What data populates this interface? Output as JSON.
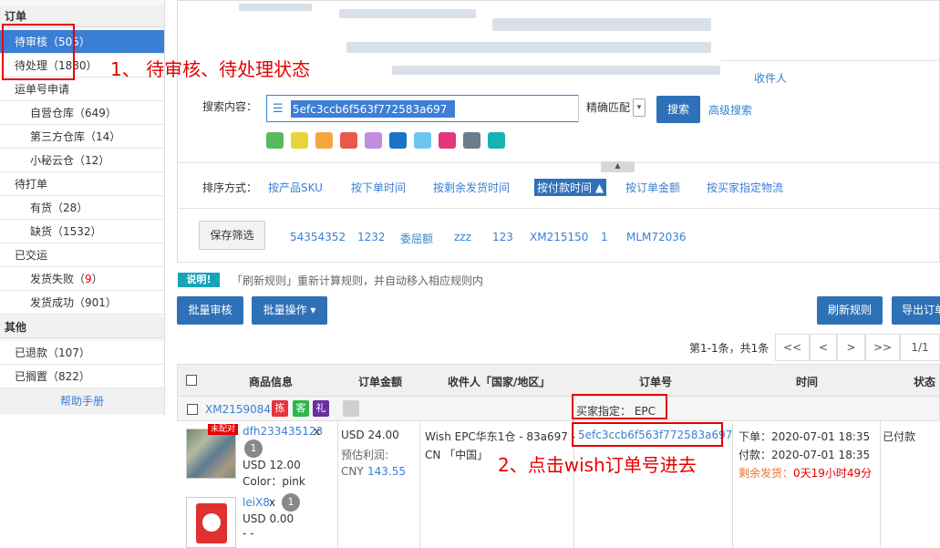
{
  "sidebar": {
    "sections": [
      {
        "label": "订单"
      },
      {
        "label": "其他"
      }
    ],
    "items": [
      {
        "label": "待审核",
        "count": "（505）"
      },
      {
        "label": "待处理",
        "count": "（1880）"
      },
      {
        "label": "运单号申请",
        "count": ""
      },
      {
        "label": "自营仓库",
        "count": "（649）"
      },
      {
        "label": "第三方仓库",
        "count": "（14）"
      },
      {
        "label": "小秘云仓",
        "count": "（12）"
      },
      {
        "label": "待打单",
        "count": ""
      },
      {
        "label": "有货",
        "count": "（28）"
      },
      {
        "label": "缺货",
        "count": "（1532）"
      },
      {
        "label": "已交运",
        "count": ""
      },
      {
        "label": "发货失败",
        "count_pre": "（",
        "count_num": "9",
        "count_post": "）"
      },
      {
        "label": "发货成功",
        "count": "（901）"
      },
      {
        "label": "已退款",
        "count": "（107）"
      },
      {
        "label": "已搁置",
        "count": "（822）"
      }
    ],
    "help": "帮助手册"
  },
  "annotations": {
    "step1": "1、 待审核、待处理状态",
    "step2": "2、点击wish订单号进去"
  },
  "search": {
    "recipient_link": "收件人",
    "label": "搜索内容：",
    "value": "5efc3ccb6f563f772583a697",
    "match_mode": "精确匹配",
    "search_button": "搜索",
    "advanced": "高级搜索",
    "swatch_colors": [
      "#5cb85c",
      "#e8d43a",
      "#f5a742",
      "#e8594a",
      "#c18de0",
      "#1a73c7",
      "#6ec6f0",
      "#e5357e",
      "#6b7c8a",
      "#17b3b3"
    ]
  },
  "sort": {
    "label": "排序方式：",
    "options": [
      "按产品SKU",
      "按下单时间",
      "按剩余发货时间",
      "按付款时间 ▲",
      "按订单金额",
      "按买家指定物流"
    ],
    "active": "按付款时间 ▲"
  },
  "filters": {
    "save_button": "保存筛选",
    "saved": [
      "54354352",
      "1232",
      "委屈额",
      "zzz",
      "123",
      "XM215150",
      "1",
      "MLM72036"
    ]
  },
  "notice": {
    "tag": "说明!",
    "text": "「刷新规则」重新计算规则，并自动移入相应规则内"
  },
  "actions": {
    "batch_review": "批量审核",
    "batch_ops": "批量操作 ▾",
    "refresh_rules": "刷新规则",
    "export": "导出订单"
  },
  "pager": {
    "summary": "第1-1条，共1条",
    "first": "<<",
    "prev": "<",
    "next": ">",
    "last": ">>",
    "page": "1/1"
  },
  "table": {
    "headers": [
      "商品信息",
      "订单金额",
      "收件人「国家/地区」",
      "订单号",
      "时间",
      "状态"
    ]
  },
  "order": {
    "id": "XM2159084",
    "tags": [
      {
        "text": "拣",
        "color": "#e8323c"
      },
      {
        "text": "客",
        "color": "#2eb84a"
      },
      {
        "text": "礼",
        "color": "#6a2ea0"
      }
    ],
    "buyer_logistics": "买家指定： EPC",
    "items": [
      {
        "sku": "dfh233435123",
        "qty_sep": "x",
        "qty": "1",
        "price": "USD 12.00",
        "color": "Color：pink",
        "badge": "未配对"
      },
      {
        "sku": "leiX8",
        "qty_sep": "x",
        "qty": "1",
        "price": "USD 0.00",
        "color": "- -"
      }
    ],
    "amount": "USD 24.00",
    "profit_label": "预估利润:",
    "profit_currency": "CNY",
    "profit_value": "143.55",
    "recipient_line1": "Wish EPC华东1仓 - 83a697 -",
    "recipient_line2": "CN 「中国」",
    "order_no": "5efc3ccb6f563f772583a697",
    "placed": "下单：2020-07-01 18:35",
    "paid": "付款：2020-07-01 18:35",
    "remaining_label": "剩余发货：",
    "remaining_value": "0天19小时49分",
    "status": "已付款"
  }
}
